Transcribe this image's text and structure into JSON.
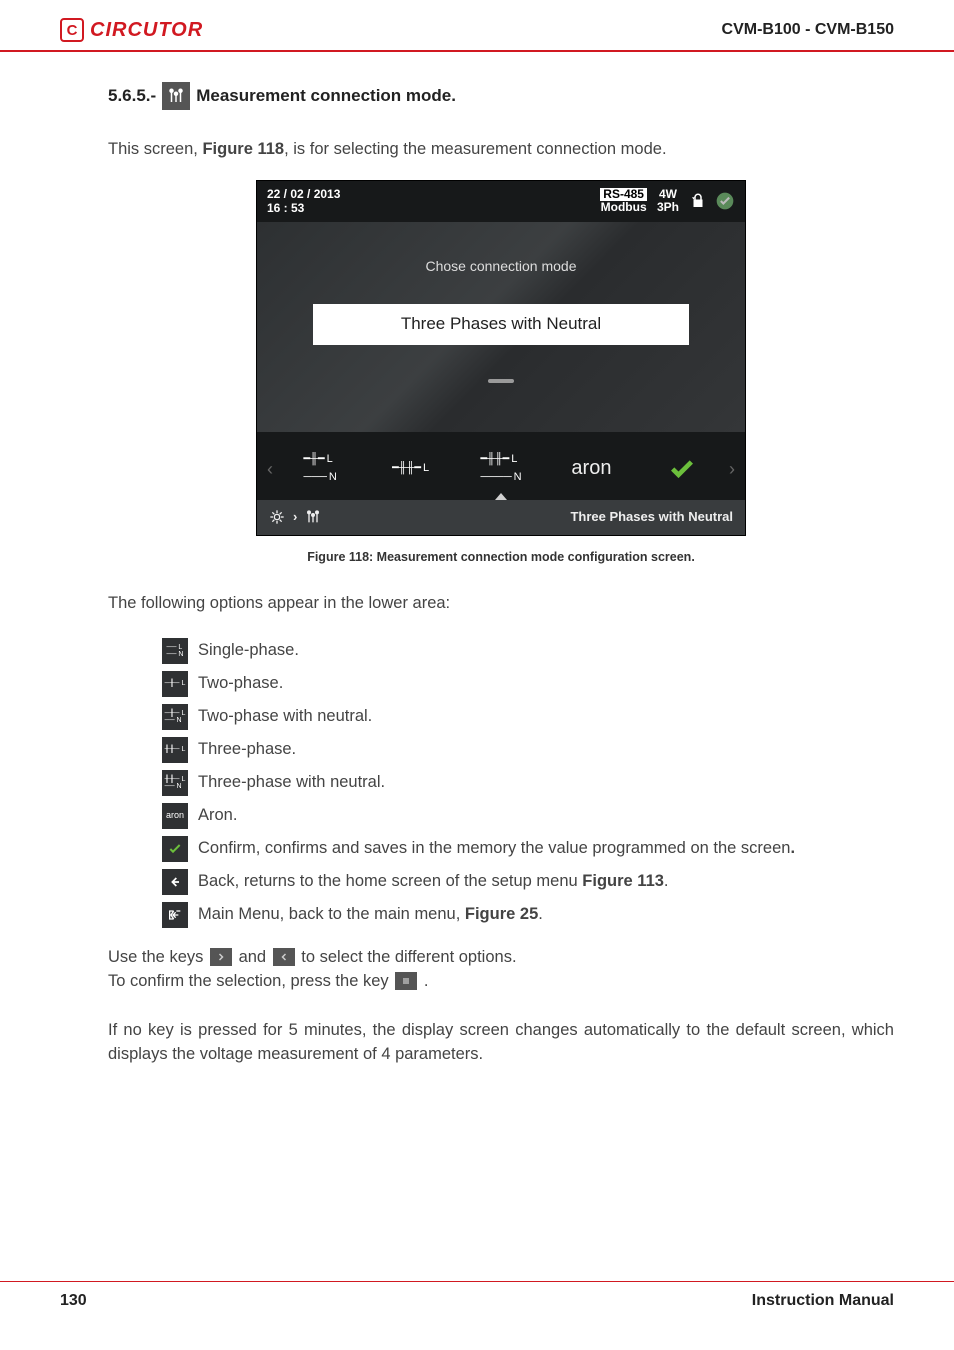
{
  "header": {
    "brand": "CIRCUTOR",
    "model": "CVM-B100 - CVM-B150"
  },
  "section": {
    "number": "5.6.5.-",
    "title": "Measurement connection mode."
  },
  "intro": {
    "pre": "This screen, ",
    "figref": "Figure 118",
    "post": ", is for selecting the measurement connection mode."
  },
  "device": {
    "date": "22 / 02 / 2013",
    "time": "16 : 53",
    "rs_label": "RS-485",
    "modbus": "Modbus",
    "wiring1": "4W",
    "wiring2": "3Ph",
    "prompt": "Chose connection mode",
    "value": "Three Phases with Neutral",
    "opts": {
      "aron": "aron"
    },
    "breadcrumb_label": "Three Phases with Neutral"
  },
  "caption": "Figure 118: Measurement connection mode configuration screen.",
  "lower_intro": "The following options appear in the lower area:",
  "options": [
    {
      "label": "Single-phase."
    },
    {
      "label": "Two-phase."
    },
    {
      "label": "Two-phase with neutral."
    },
    {
      "label": "Three-phase."
    },
    {
      "label": "Three-phase with neutral."
    },
    {
      "label": "Aron.",
      "badge": "aron"
    },
    {
      "label_pre": "Confirm, confirms and saves in the memory the value programmed on the screen",
      "label_post": "."
    },
    {
      "label_pre": "Back, returns to the home screen of the setup menu ",
      "figref": "Figure 113",
      "label_post": "."
    },
    {
      "label_pre": "Main Menu, back to the main menu, ",
      "figref": "Figure 25",
      "label_post": "."
    }
  ],
  "instructions": {
    "line1_pre": "Use the keys ",
    "line1_mid": " and ",
    "line1_post": " to select the different options.",
    "line2_pre": "To confirm the selection, press the key ",
    "line2_post": "."
  },
  "timeout": "If no key is pressed for 5 minutes, the display screen changes automatically to the default screen, which displays the voltage measurement of 4 parameters.",
  "footer": {
    "page": "130",
    "label": "Instruction Manual"
  }
}
